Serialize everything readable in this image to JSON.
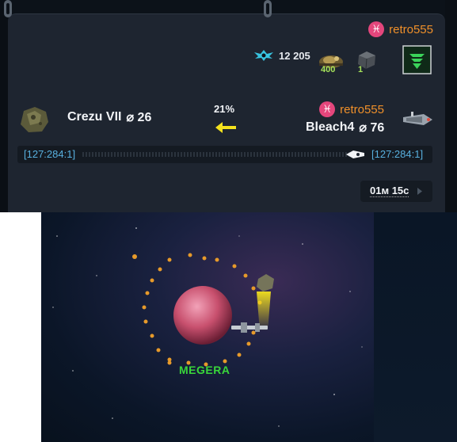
{
  "header": {
    "player_name": "retro555",
    "player_icon": "pisces-icon",
    "stats": {
      "fleet_power": "12 205",
      "unit_count": "400",
      "resource_count": "1"
    }
  },
  "mission": {
    "origin_name": "Crezu VII",
    "origin_diameter": "⌀ 26",
    "target_owner": "retro555",
    "target_name": "Bleach4",
    "target_diameter": "⌀ 76",
    "progress": "21%",
    "progress_value": 0.21,
    "origin_coords": "[127:284:1]",
    "target_coords": "[127:284:1]",
    "timer": "01м 15с"
  },
  "map": {
    "planet_name": "MEGERA"
  },
  "colors": {
    "player_name": "#f0902a",
    "pisces_badge": "#e4467c",
    "coords": "#58b0df",
    "arrow": "#f4e21d",
    "planet_label": "#39d63a",
    "panel_bg": "#1e2530"
  }
}
